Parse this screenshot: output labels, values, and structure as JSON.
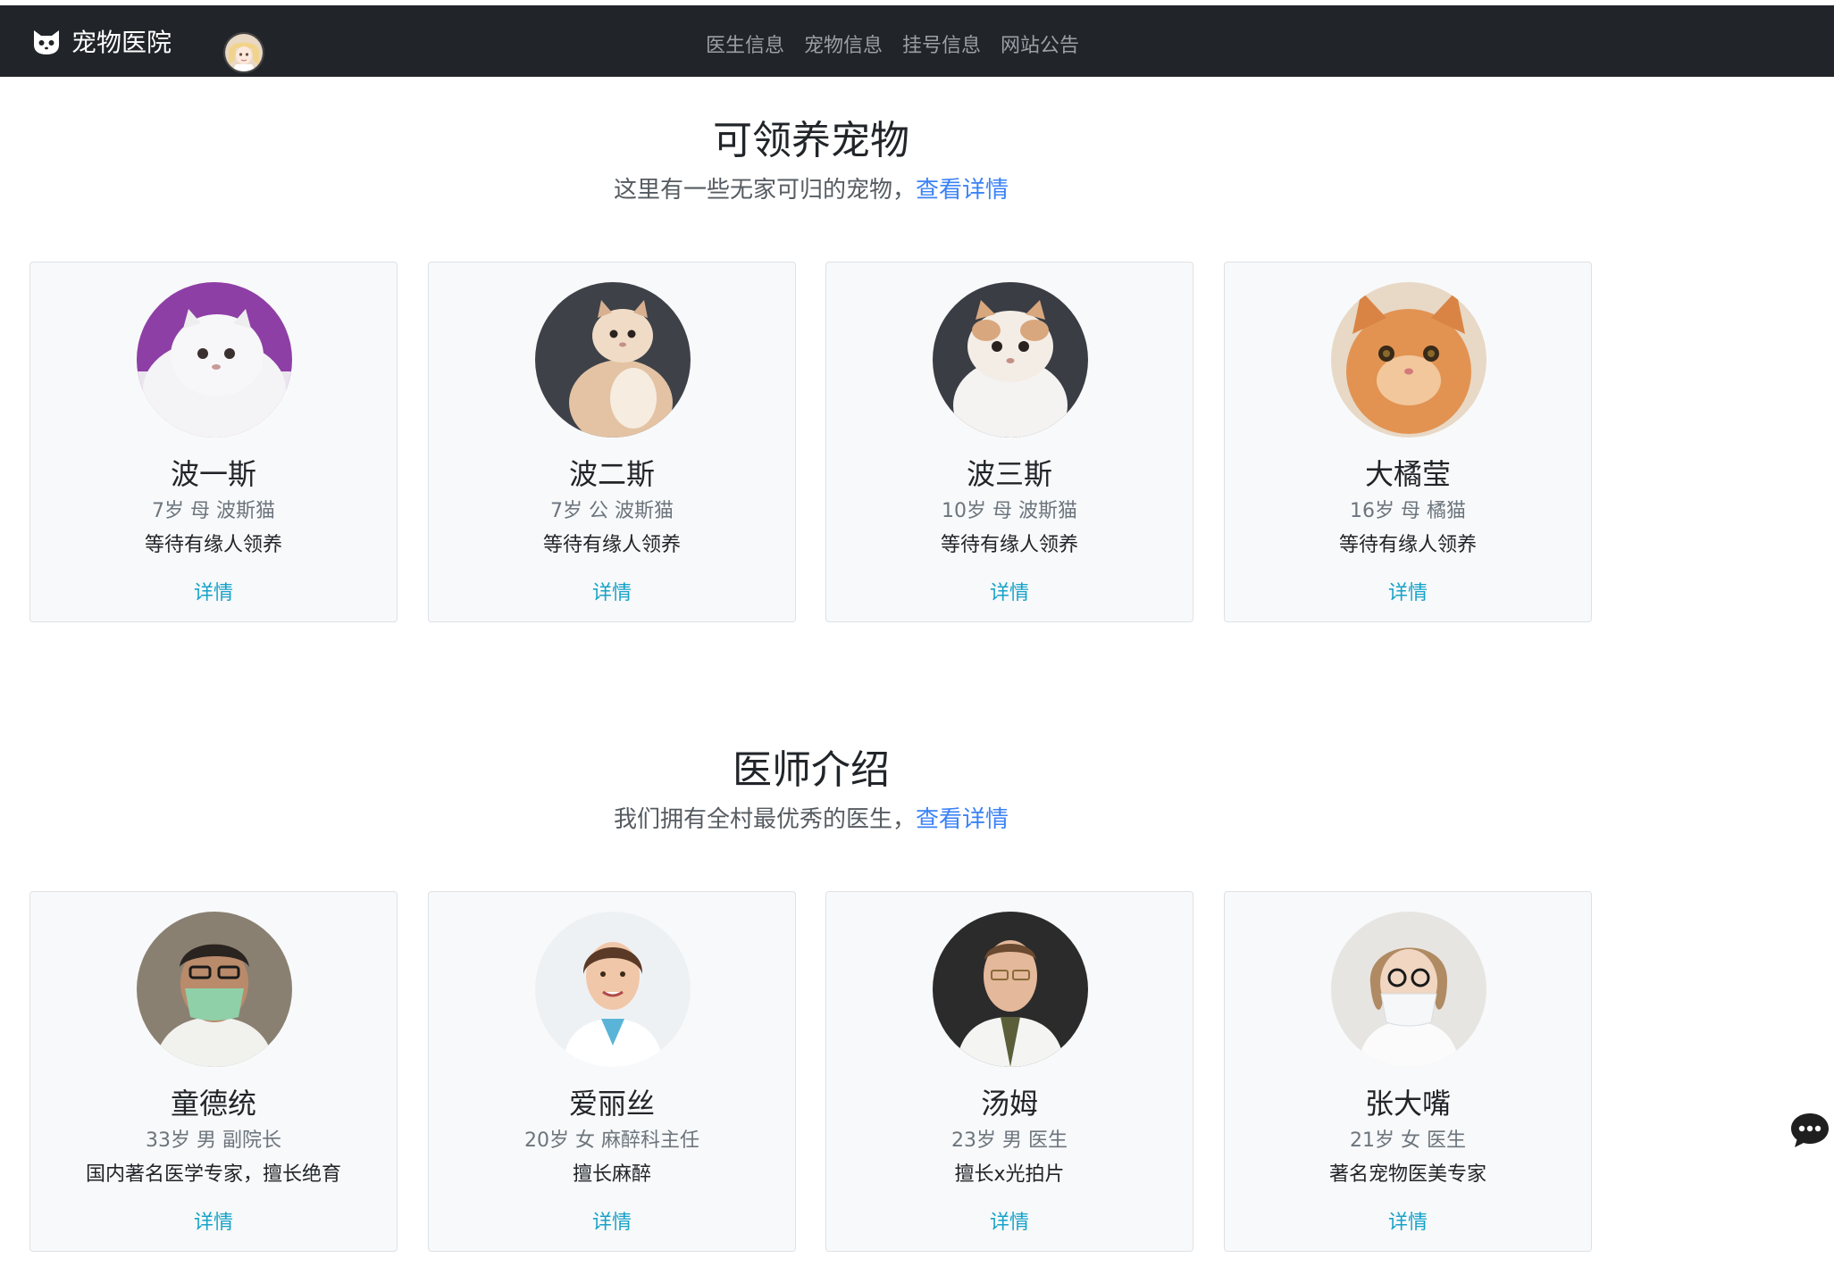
{
  "navbar": {
    "brand": "宠物医院",
    "links": [
      "医生信息",
      "宠物信息",
      "挂号信息",
      "网站公告"
    ]
  },
  "pets_section": {
    "title": "可领养宠物",
    "subtitle": "这里有一些无家可归的宠物，",
    "link": "查看详情",
    "cards": [
      {
        "name": "波一斯",
        "meta": "7岁 母 波斯猫",
        "desc": "等待有缘人领养",
        "detail": "详情"
      },
      {
        "name": "波二斯",
        "meta": "7岁 公 波斯猫",
        "desc": "等待有缘人领养",
        "detail": "详情"
      },
      {
        "name": "波三斯",
        "meta": "10岁 母 波斯猫",
        "desc": "等待有缘人领养",
        "detail": "详情"
      },
      {
        "name": "大橘莹",
        "meta": "16岁 母 橘猫",
        "desc": "等待有缘人领养",
        "detail": "详情"
      }
    ]
  },
  "doctors_section": {
    "title": "医师介绍",
    "subtitle": "我们拥有全村最优秀的医生，",
    "link": "查看详情",
    "cards": [
      {
        "name": "童德统",
        "meta": "33岁 男 副院长",
        "desc": "国内著名医学专家，擅长绝育",
        "detail": "详情"
      },
      {
        "name": "爱丽丝",
        "meta": "20岁 女 麻醉科主任",
        "desc": "擅长麻醉",
        "detail": "详情"
      },
      {
        "name": "汤姆",
        "meta": "23岁 男 医生",
        "desc": "擅长x光拍片",
        "detail": "详情"
      },
      {
        "name": "张大嘴",
        "meta": "21岁 女 医生",
        "desc": "著名宠物医美专家",
        "detail": "详情"
      }
    ]
  },
  "colors": {
    "navbar_bg": "#212529",
    "link_blue": "#3b82f6",
    "detail_cyan": "#17a2c8",
    "card_bg": "#f8f9fa"
  },
  "icons": {
    "brand": "cat-face-icon",
    "chat": "chat-bubble-icon"
  }
}
